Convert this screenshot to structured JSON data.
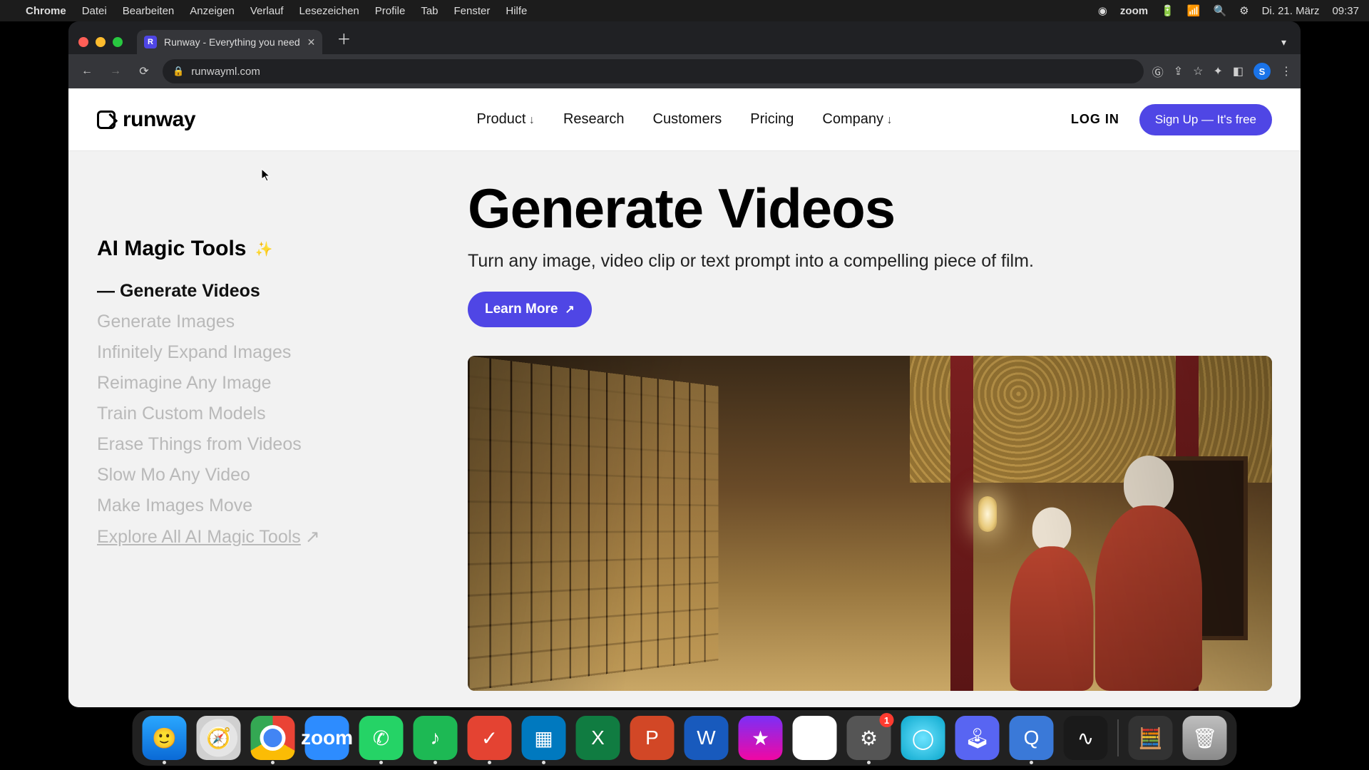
{
  "mac": {
    "app": "Chrome",
    "menus": [
      "Datei",
      "Bearbeiten",
      "Anzeigen",
      "Verlauf",
      "Lesezeichen",
      "Profile",
      "Tab",
      "Fenster",
      "Hilfe"
    ],
    "right": {
      "zoom": "zoom",
      "date": "Di. 21. März",
      "time": "09:37"
    }
  },
  "tab": {
    "title": "Runway - Everything you need"
  },
  "omnibox": {
    "url": "runwayml.com"
  },
  "profile_initial": "S",
  "site": {
    "brand": "runway",
    "nav": {
      "product": "Product",
      "research": "Research",
      "customers": "Customers",
      "pricing": "Pricing",
      "company": "Company"
    },
    "login": "LOG IN",
    "signup": "Sign Up — It's free"
  },
  "sidebar": {
    "heading": "AI Magic Tools",
    "items": [
      "Generate Videos",
      "Generate Images",
      "Infinitely Expand Images",
      "Reimagine Any Image",
      "Train Custom Models",
      "Erase Things from Videos",
      "Slow Mo Any Video",
      "Make Images Move"
    ],
    "explore": "Explore All AI Magic Tools"
  },
  "hero": {
    "title": "Generate Videos",
    "subtitle": "Turn any image, video clip or text prompt into a compelling piece of film.",
    "cta": "Learn More"
  },
  "dock": {
    "settings_badge": "1",
    "zoom_label": "zoom"
  }
}
